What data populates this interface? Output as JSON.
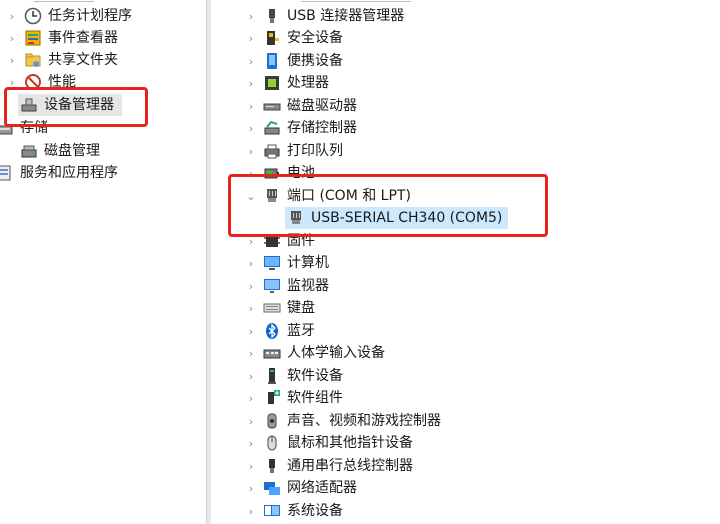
{
  "left_tree": {
    "items": [
      {
        "label": "任务计划程序",
        "icon": "clock-icon",
        "name": "task-scheduler"
      },
      {
        "label": "事件查看器",
        "icon": "event-viewer-icon",
        "name": "event-viewer"
      },
      {
        "label": "共享文件夹",
        "icon": "shared-folder-icon",
        "name": "shared-folders"
      },
      {
        "label": "性能",
        "icon": "performance-icon",
        "name": "performance"
      },
      {
        "label": "设备管理器",
        "icon": "device-manager-icon",
        "name": "device-manager"
      },
      {
        "label": "存储",
        "icon": "storage-icon",
        "name": "storage"
      },
      {
        "label": "磁盘管理",
        "icon": "disk-management-icon",
        "name": "disk-management"
      },
      {
        "label": "服务和应用程序",
        "icon": "services-icon",
        "name": "services-applications"
      }
    ]
  },
  "device_tree": {
    "categories": [
      {
        "label": "USB 连接器管理器",
        "icon": "usb-connector-icon"
      },
      {
        "label": "安全设备",
        "icon": "security-device-icon"
      },
      {
        "label": "便携设备",
        "icon": "portable-device-icon"
      },
      {
        "label": "处理器",
        "icon": "processor-icon"
      },
      {
        "label": "磁盘驱动器",
        "icon": "disk-drive-icon"
      },
      {
        "label": "存储控制器",
        "icon": "storage-controller-icon"
      },
      {
        "label": "打印队列",
        "icon": "printer-icon"
      },
      {
        "label": "电池",
        "icon": "battery-icon"
      },
      {
        "label": "端口 (COM 和 LPT)",
        "icon": "port-icon"
      },
      {
        "label": "USB-SERIAL CH340 (COM5)",
        "icon": "port-icon"
      },
      {
        "label": "固件",
        "icon": "firmware-icon"
      },
      {
        "label": "计算机",
        "icon": "computer-icon"
      },
      {
        "label": "监视器",
        "icon": "monitor-icon"
      },
      {
        "label": "键盘",
        "icon": "keyboard-icon"
      },
      {
        "label": "蓝牙",
        "icon": "bluetooth-icon"
      },
      {
        "label": "人体学输入设备",
        "icon": "hid-icon"
      },
      {
        "label": "软件设备",
        "icon": "software-device-icon"
      },
      {
        "label": "软件组件",
        "icon": "software-component-icon"
      },
      {
        "label": "声音、视频和游戏控制器",
        "icon": "sound-icon"
      },
      {
        "label": "鼠标和其他指针设备",
        "icon": "mouse-icon"
      },
      {
        "label": "通用串行总线控制器",
        "icon": "usb-controller-icon"
      },
      {
        "label": "网络适配器",
        "icon": "network-adapter-icon"
      },
      {
        "label": "系统设备",
        "icon": "system-device-icon"
      }
    ]
  },
  "colors": {
    "highlight": "#e8231c",
    "selection": "#cce8ff"
  }
}
